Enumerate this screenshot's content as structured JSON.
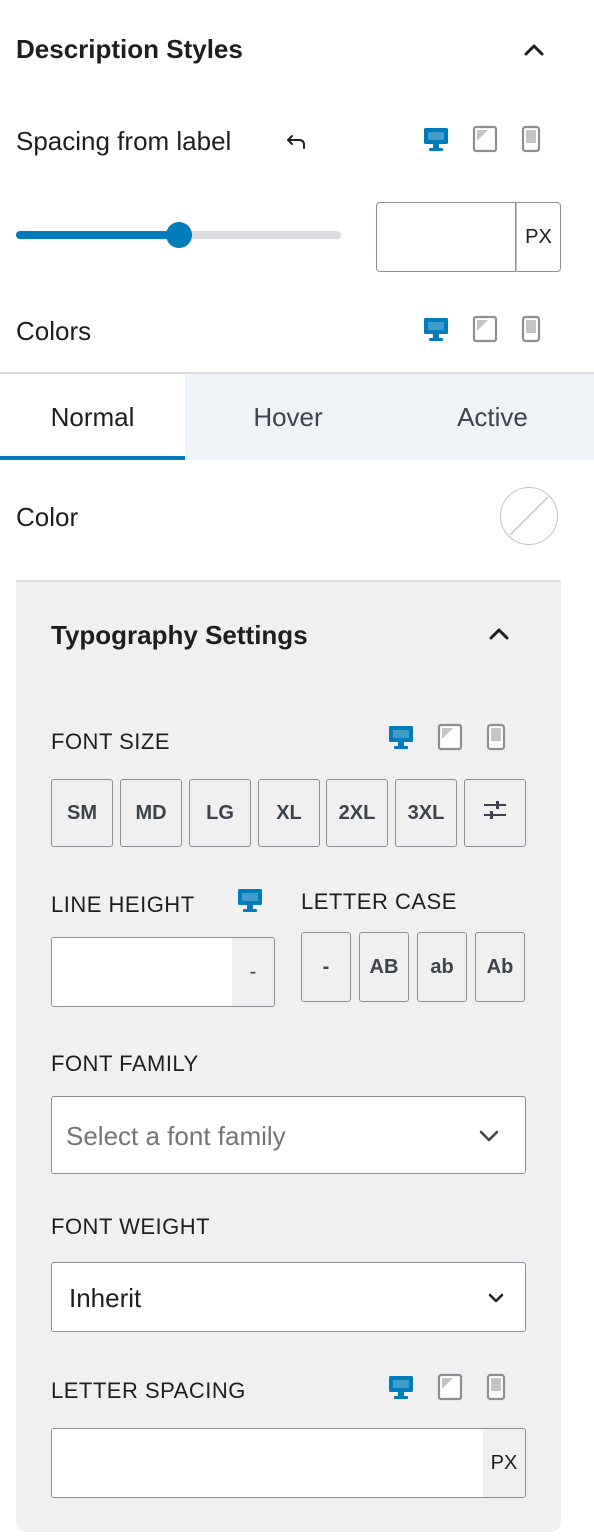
{
  "header": {
    "title": "Description Styles"
  },
  "spacing": {
    "label": "Spacing from label",
    "slider_fraction": 0.5,
    "input_value": "",
    "unit": "PX"
  },
  "colors": {
    "label": "Colors",
    "tabs": [
      "Normal",
      "Hover",
      "Active"
    ],
    "active_tab": "Normal",
    "color_label": "Color"
  },
  "typography": {
    "title": "Typography Settings",
    "font_size": {
      "label": "FONT SIZE",
      "presets": [
        "SM",
        "MD",
        "LG",
        "XL",
        "2XL",
        "3XL"
      ]
    },
    "line_height": {
      "label": "LINE HEIGHT",
      "value": "",
      "unit": "-"
    },
    "letter_case": {
      "label": "LETTER CASE",
      "options": [
        "-",
        "AB",
        "ab",
        "Ab"
      ]
    },
    "font_family": {
      "label": "FONT FAMILY",
      "placeholder": "Select a font family"
    },
    "font_weight": {
      "label": "FONT WEIGHT",
      "value": "Inherit"
    },
    "letter_spacing": {
      "label": "LETTER SPACING",
      "value": "",
      "unit": "PX"
    }
  },
  "theme": {
    "accent": "#007cba",
    "border": "#8c8f94",
    "panel_bg": "#f0f0f1",
    "tab_bg": "#eef3f8"
  }
}
